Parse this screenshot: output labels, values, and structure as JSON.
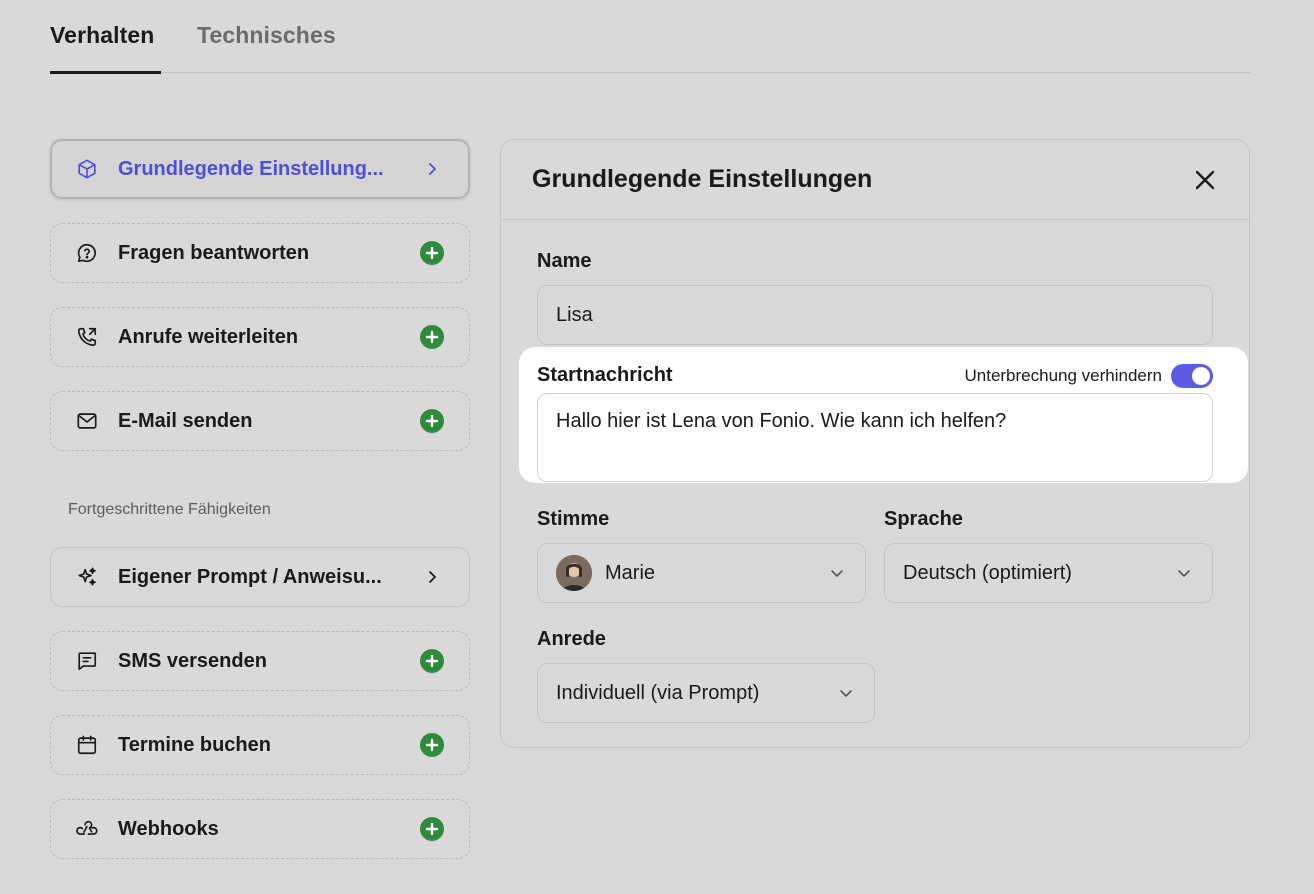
{
  "tabs": [
    {
      "label": "Verhalten",
      "active": true
    },
    {
      "label": "Technisches",
      "active": false
    }
  ],
  "capabilities": [
    {
      "label": "Grundlegende Einstellung...",
      "icon": "box-icon",
      "action": "chevron"
    },
    {
      "label": "Fragen beantworten",
      "icon": "question-bubble-icon",
      "action": "add"
    },
    {
      "label": "Anrufe weiterleiten",
      "icon": "phone-forward-icon",
      "action": "add"
    },
    {
      "label": "E-Mail senden",
      "icon": "mail-icon",
      "action": "add"
    }
  ],
  "advanced": {
    "section_label": "Fortgeschrittene Fähigkeiten",
    "items": [
      {
        "label": "Eigener Prompt / Anweisu...",
        "icon": "sparkles-icon",
        "action": "chevron"
      },
      {
        "label": "SMS versenden",
        "icon": "message-icon",
        "action": "add"
      },
      {
        "label": "Termine buchen",
        "icon": "calendar-icon",
        "action": "add"
      },
      {
        "label": "Webhooks",
        "icon": "webhook-icon",
        "action": "add"
      }
    ]
  },
  "panel": {
    "title": "Grundlegende Einstellungen",
    "name_label": "Name",
    "name_value": "Lisa",
    "start_label": "Startnachricht",
    "toggle_label": "Unterbrechung verhindern",
    "toggle_on": true,
    "start_value": "Hallo hier ist Lena von Fonio. Wie kann ich helfen?",
    "voice_label": "Stimme",
    "voice_value": "Marie",
    "language_label": "Sprache",
    "language_value": "Deutsch (optimiert)",
    "salutation_label": "Anrede",
    "salutation_value": "Individuell (via Prompt)"
  },
  "colors": {
    "accent": "#5b5be6",
    "add_green": "#2e8b3a",
    "background": "#d9d9d9"
  }
}
